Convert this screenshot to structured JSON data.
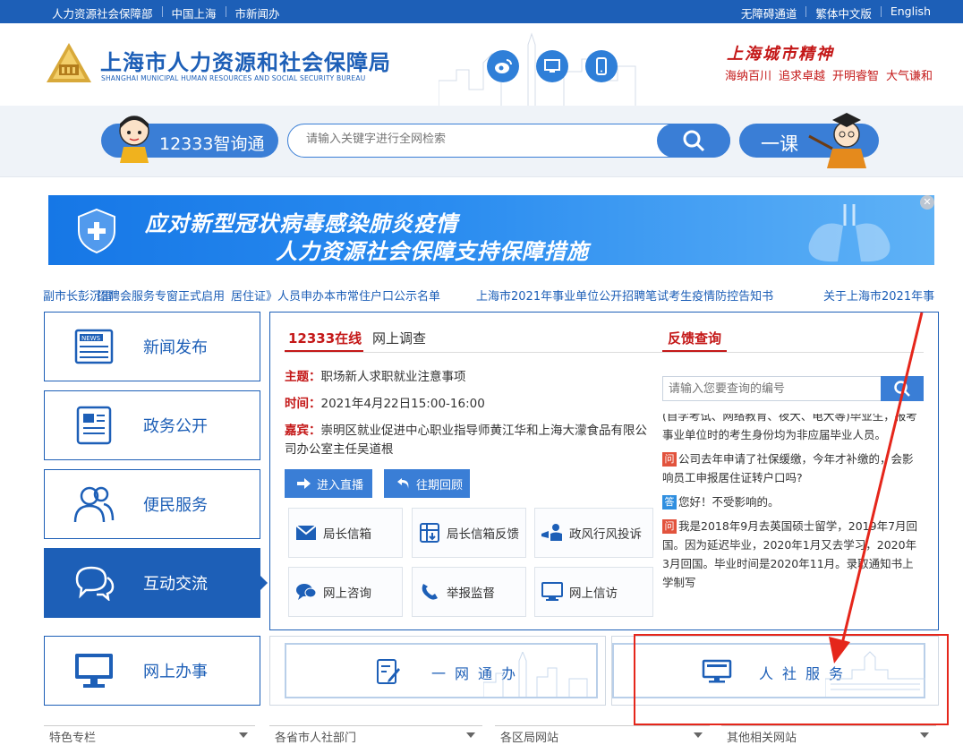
{
  "topbar": {
    "left_links": [
      "人力资源社会保障部",
      "中国上海",
      "市新闻办"
    ],
    "right_links": [
      "无障碍通道",
      "繁体中文版",
      "English"
    ]
  },
  "header": {
    "title": "上海市人力资源和社会保障局",
    "subtitle": "SHANGHAI MUNICIPAL HUMAN RESOURCES AND SOCIAL SECURITY BUREAU",
    "icons": [
      "weibo-icon",
      "desktop-icon",
      "mobile-icon"
    ],
    "spirit_title": "上海城市精神",
    "spirit_words": [
      "海纳百川",
      "追求卓越",
      "开明睿智",
      "大气谦和"
    ]
  },
  "search": {
    "zhixuntong_label": "12333智询通",
    "placeholder": "请输入关键字进行全网检索",
    "yike_label": "一课"
  },
  "banner": {
    "line1": "应对新型冠状病毒感染肺炎疫情",
    "line2": "人力资源社会保障支持保障措施",
    "close": "✕"
  },
  "ticker": [
    "副市长彭沉雷",
    "招聘会服务专窗正式启用",
    "居住证》人员申办本市常住户口公示名单",
    "上海市2021年事业单位公开招聘笔试考生疫情防控告知书",
    "关于上海市2021年事"
  ],
  "nav": [
    {
      "label": "新闻发布",
      "icon": "news-icon"
    },
    {
      "label": "政务公开",
      "icon": "document-icon"
    },
    {
      "label": "便民服务",
      "icon": "people-icon"
    },
    {
      "label": "互动交流",
      "icon": "chat-icon"
    },
    {
      "label": "网上办事",
      "icon": "monitor-icon"
    }
  ],
  "panel": {
    "tabs": [
      "12333在线",
      "网上调查"
    ],
    "feedback_tab": "反馈查询",
    "topic_label": "主题：",
    "topic": "职场新人求职就业注意事项",
    "time_label": "时间：",
    "time": "2021年4月22日15:00-16:00",
    "guest_label": "嘉宾：",
    "guest": "崇明区就业促进中心职业指导师黄江华和上海大濛食品有限公司办公室主任吴道根",
    "live_button": "进入直播",
    "review_button": "往期回顾",
    "tiles": [
      {
        "label": "局长信箱",
        "icon": "mail-icon"
      },
      {
        "label": "局长信箱反馈",
        "icon": "inbox-icon"
      },
      {
        "label": "政风行风投诉",
        "icon": "megaphone-icon"
      },
      {
        "label": "网上咨询",
        "icon": "speech-icon"
      },
      {
        "label": "举报监督",
        "icon": "phone-icon"
      },
      {
        "label": "网上信访",
        "icon": "screen-icon"
      }
    ],
    "feedback_placeholder": "请输入您要查询的编号",
    "feedback_items": [
      {
        "type": "text",
        "text": "(自学考试、网络教育、夜大、电大等)毕业生，报考事业单位时的考生身份均为非应届毕业人员。"
      },
      {
        "type": "q",
        "badge": "问",
        "text": "公司去年申请了社保缓缴，今年才补缴的，会影响员工申报居住证转户口吗?"
      },
      {
        "type": "a",
        "badge": "答",
        "text": "您好！不受影响的。"
      },
      {
        "type": "q",
        "badge": "问",
        "text": "我是2018年9月去英国硕士留学，2019年7月回国。因为延迟毕业，2020年1月又去学习，2020年3月回国。毕业时间是2020年11月。录取通知书上学制写"
      }
    ]
  },
  "services": [
    {
      "label": "一网通办",
      "icon": "form-edit-icon"
    },
    {
      "label": "人社服务",
      "icon": "computer-icon"
    }
  ],
  "dropdowns": [
    "特色专栏",
    "各省市人社部门",
    "各区局网站",
    "其他相关网站"
  ]
}
